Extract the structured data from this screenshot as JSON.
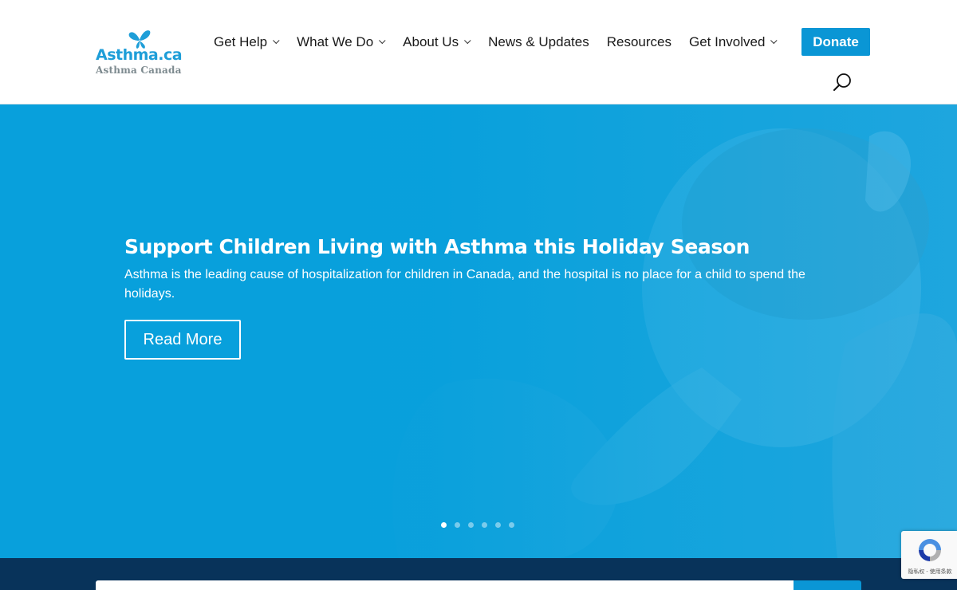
{
  "header": {
    "logo": {
      "wordmark": "Asthma.ca",
      "subtitle": "Asthma Canada"
    },
    "nav": [
      {
        "label": "Get Help",
        "has_dropdown": true
      },
      {
        "label": "What We Do",
        "has_dropdown": true
      },
      {
        "label": "About Us",
        "has_dropdown": true
      },
      {
        "label": "News & Updates",
        "has_dropdown": false
      },
      {
        "label": "Resources",
        "has_dropdown": false
      },
      {
        "label": "Get Involved",
        "has_dropdown": true
      }
    ],
    "donate_label": "Donate",
    "search_icon": "search-icon"
  },
  "hero": {
    "title": "Support Children Living with Asthma this Holiday Season",
    "text": "Asthma is the leading cause of hospitalization for children in Canada, and the hospital is no place for a child to spend the holidays.",
    "button_label": "Read More",
    "slides_count": 6,
    "active_slide": 1
  },
  "recaptcha": {
    "text": "隐私权 - 使用条款"
  },
  "colors": {
    "brand_blue": "#0a96d5",
    "hero_blue": "#12a2db",
    "navy": "#08335a",
    "logo_gray": "#7d8a8f"
  }
}
